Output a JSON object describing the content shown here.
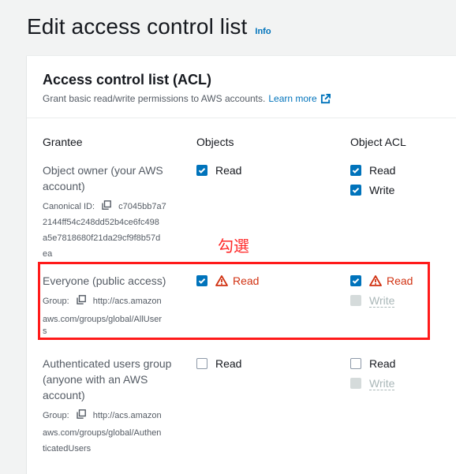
{
  "page": {
    "title": "Edit access control list",
    "info_link": "Info"
  },
  "acl_panel": {
    "title": "Access control list (ACL)",
    "description": "Grant basic read/write permissions to AWS accounts.",
    "learn_more": "Learn more"
  },
  "columns": {
    "grantee": "Grantee",
    "objects": "Objects",
    "object_acl": "Object ACL"
  },
  "rows": [
    {
      "grantee_lines": [
        "Object owner (your AWS",
        "account)"
      ],
      "id_label": "Canonical ID:",
      "id_lines": [
        "c7045bb7a7",
        "2144ff54c248dd52b4ce6fc498",
        "a5e7818680f21da29cf9f8b57d",
        "ea"
      ],
      "objects_read": {
        "label": "Read",
        "checked": true,
        "warning": false
      },
      "acl_read": {
        "label": "Read",
        "checked": true,
        "warning": false
      },
      "acl_write": {
        "label": "Write",
        "checked": true,
        "disabled": false
      }
    },
    {
      "grantee_lines": [
        "Everyone (public access)"
      ],
      "id_label": "Group:",
      "id_lines": [
        "http://acs.amazon",
        "aws.com/groups/global/AllUser",
        "s"
      ],
      "objects_read": {
        "label": "Read",
        "checked": true,
        "warning": true
      },
      "acl_read": {
        "label": "Read",
        "checked": true,
        "warning": true
      },
      "acl_write": {
        "label": "Write",
        "checked": false,
        "disabled": true
      }
    },
    {
      "grantee_lines": [
        "Authenticated users group",
        "(anyone with an AWS",
        "account)"
      ],
      "id_label": "Group:",
      "id_lines": [
        "http://acs.amazon",
        "aws.com/groups/global/Authen",
        "ticatedUsers"
      ],
      "objects_read": {
        "label": "Read",
        "checked": false,
        "warning": false
      },
      "acl_read": {
        "label": "Read",
        "checked": false,
        "warning": false
      },
      "acl_write": {
        "label": "Write",
        "checked": false,
        "disabled": true
      }
    }
  ],
  "annotation": {
    "text": "勾選",
    "color": "#ff1a1a"
  },
  "colors": {
    "accent": "#0073bb",
    "warning": "#d13212"
  }
}
